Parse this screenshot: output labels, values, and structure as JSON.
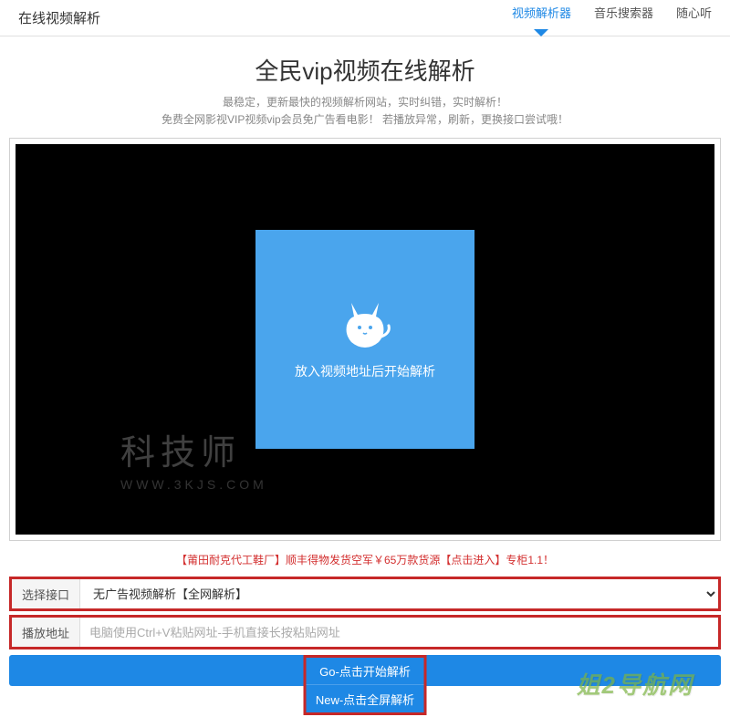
{
  "header": {
    "title": "在线视频解析",
    "tabs": [
      {
        "label": "视频解析器",
        "active": true
      },
      {
        "label": "音乐搜索器",
        "active": false
      },
      {
        "label": "随心听",
        "active": false
      }
    ]
  },
  "main": {
    "title": "全民vip视频在线解析",
    "subtitle_line1": "最稳定，更新最快的视频解析网站，实时纠错，实时解析！",
    "subtitle_line2": "免费全网影视VIP视频vip会员免广告看电影！ 若播放异常，刷新，更换接口尝试哦！"
  },
  "player": {
    "placeholder_text": "放入视频地址后开始解析",
    "watermark": "科技师",
    "watermark_url": "WWW.3KJS.COM"
  },
  "ad": {
    "text": "【莆田耐克代工鞋厂】顺丰得物发货空军￥65万款货源【点击进入】专柜1.1！"
  },
  "form": {
    "interface_label": "选择接口",
    "interface_value": "无广告视频解析【全网解析】",
    "address_label": "播放地址",
    "address_placeholder": "电脑使用Ctrl+V粘贴网址-手机直接长按粘贴网址"
  },
  "buttons": {
    "go": "Go-点击开始解析",
    "new": "New-点击全屏解析"
  },
  "bottom_watermark": "姐2导航网"
}
